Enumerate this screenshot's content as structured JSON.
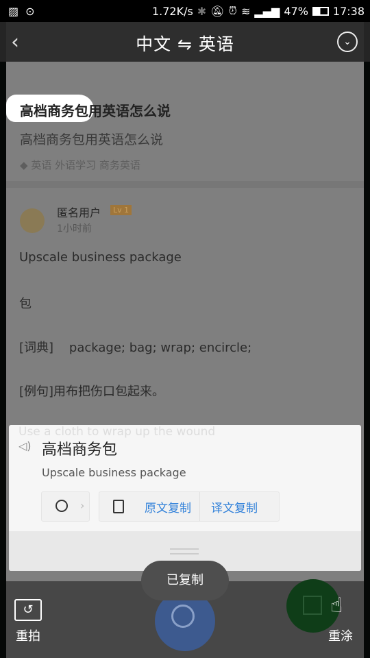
{
  "status_bar": {
    "speed": "1.72K/s",
    "battery": "47%",
    "time": "17:38",
    "icons": [
      "image-icon",
      "more-circle-icon",
      "bluetooth-icon",
      "mute-icon",
      "alarm-icon",
      "wifi-icon",
      "signal-icon",
      "signal-icon",
      "battery-icon"
    ]
  },
  "header": {
    "title": "中文 ⇋ 英语",
    "back_icon": "chevron-left-icon",
    "menu_icon": "chevron-down-circle-icon"
  },
  "question": {
    "title": "高档商务包用英语怎么说",
    "subtitle": "高档商务包用英语怎么说",
    "tags": "英语 外语学习 商务英语"
  },
  "answer": {
    "user": "匿名用户",
    "level": "Lv 1",
    "time": "1小时前",
    "lines": [
      "Upscale business package",
      "包",
      "[词典]    package; bag; wrap; encircle;",
      "[例句]用布把伤口包起来。",
      "Use a cloth to wrap up the wound"
    ]
  },
  "card": {
    "source": "高档商务包",
    "translation": "Upscale business package",
    "copy_source": "原文复制",
    "copy_translation": "译文复制",
    "accent": "#2e7fd9"
  },
  "toast": "已复制",
  "bottom": {
    "retake": "重拍",
    "repaint": "重涂"
  }
}
